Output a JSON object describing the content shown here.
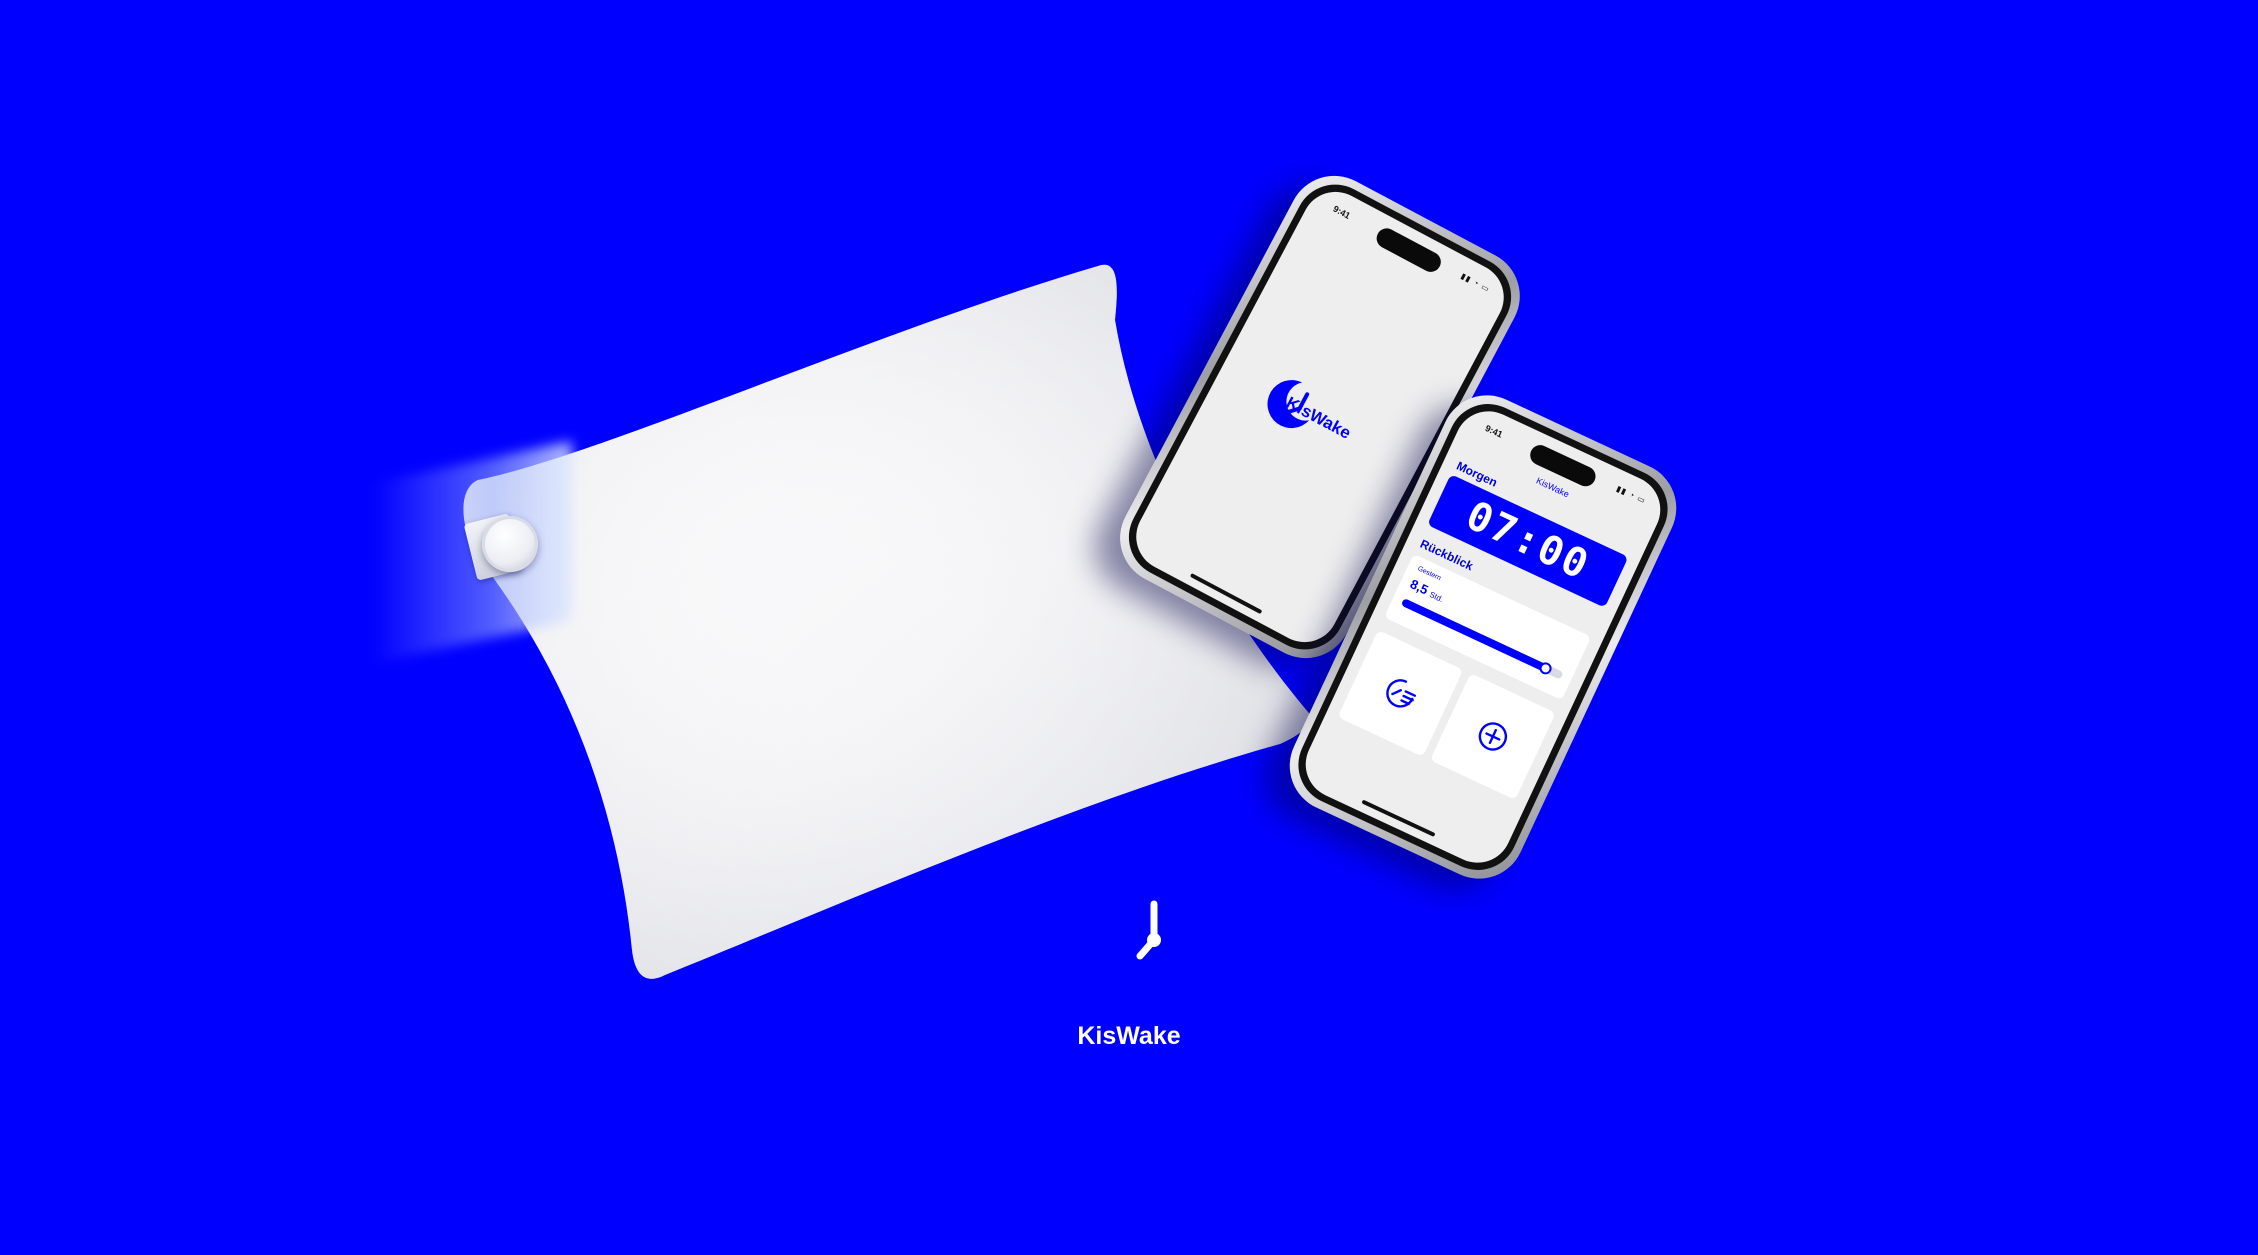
{
  "background_color": "#0000FF",
  "accent_color": "#0000FF",
  "product": {
    "name": "KisWake",
    "pillow_icon": "pillow-icon",
    "logo_icon": "moon-clock-logo-icon"
  },
  "phone_splash": {
    "status_time": "9:41",
    "logo_text": "KisWake"
  },
  "phone_app": {
    "status_time": "9:41",
    "title": "KisWake",
    "section_morning": "Morgen",
    "alarm_time": "07:00",
    "section_review": "Rückblick",
    "review_label": "Gestern",
    "review_value": "8,5",
    "review_unit": "Std.",
    "review_progress": 0.9,
    "tile_history_icon": "sleep-history-icon",
    "tile_add_icon": "add-circle-icon"
  }
}
